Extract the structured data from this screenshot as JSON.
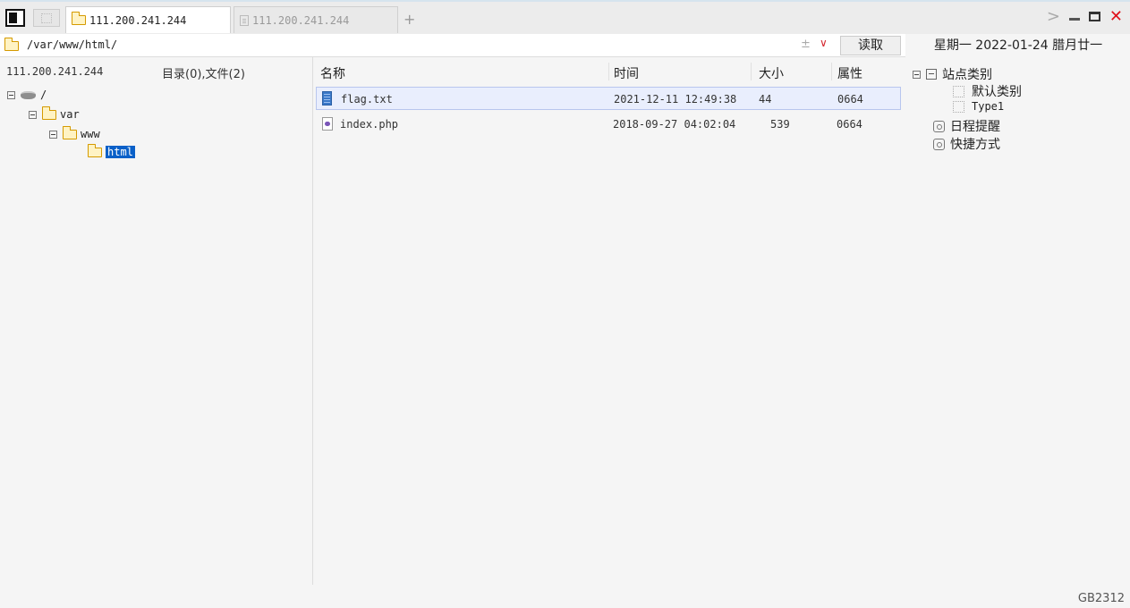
{
  "tabs": [
    {
      "label": "111.200.241.244",
      "active": true
    },
    {
      "label": "111.200.241.244",
      "active": false
    }
  ],
  "path_bar": {
    "path": "/var/www/html/",
    "pm_symbol": "±",
    "dropdown_symbol": "∨",
    "read_button": "读取"
  },
  "date_bar": "星期一 2022-01-24 腊月廿一",
  "left_panel": {
    "host": "111.200.241.244",
    "counts": "目录(0),文件(2)",
    "tree": {
      "root": "/",
      "var": "var",
      "www": "www",
      "html": "html"
    }
  },
  "file_list": {
    "columns": {
      "name": "名称",
      "time": "时间",
      "size": "大小",
      "attr": "属性"
    },
    "rows": [
      {
        "name": "flag.txt",
        "time": "2021-12-11 12:49:38",
        "size": "44",
        "attr": "0664"
      },
      {
        "name": "index.php",
        "time": "2018-09-27 04:02:04",
        "size": "539",
        "attr": "0664"
      }
    ]
  },
  "right_panel": {
    "site_category": "站点类别",
    "default_category": "默认类别",
    "type1": "Type1",
    "schedule": "日程提醒",
    "shortcut": "快捷方式"
  },
  "status": "GB2312",
  "colors": {
    "selected": "#0a60c8",
    "close": "#e0101a",
    "row_select_bg": "#e9eefd"
  }
}
